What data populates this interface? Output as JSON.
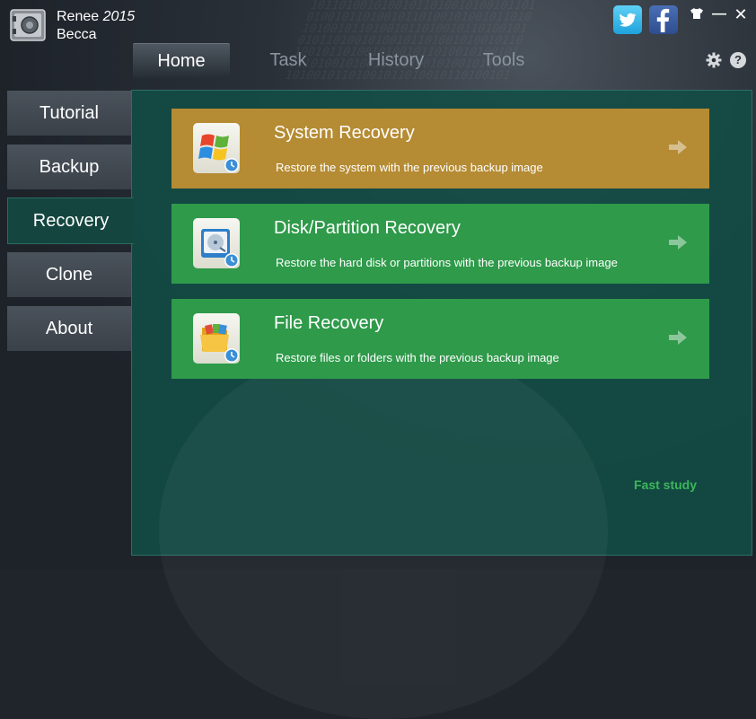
{
  "app": {
    "name": "Renee",
    "version": "2015",
    "user": "Becca"
  },
  "window_controls": {
    "minimize": "—",
    "close": "✕"
  },
  "social": {
    "twitter_icon": "twitter-icon",
    "facebook_icon": "facebook-icon"
  },
  "tabs": [
    {
      "label": "Home",
      "active": true
    },
    {
      "label": "Task",
      "active": false
    },
    {
      "label": "History",
      "active": false
    },
    {
      "label": "Tools",
      "active": false
    }
  ],
  "help_label": "?",
  "sidebar": {
    "items": [
      {
        "label": "Tutorial",
        "active": false
      },
      {
        "label": "Backup",
        "active": false
      },
      {
        "label": "Recovery",
        "active": true
      },
      {
        "label": "Clone",
        "active": false
      },
      {
        "label": "About",
        "active": false
      }
    ]
  },
  "cards": [
    {
      "title": "System Recovery",
      "desc": "Restore the system with the previous backup image",
      "color": "#b58b33",
      "icon": "windows-logo-icon"
    },
    {
      "title": "Disk/Partition Recovery",
      "desc": "Restore the hard disk or partitions with the previous backup image",
      "color": "#2e9a4a",
      "icon": "hard-disk-icon"
    },
    {
      "title": "File Recovery",
      "desc": "Restore files or folders with the previous backup image",
      "color": "#2e9a4a",
      "icon": "folder-icon"
    }
  ],
  "fast_study": "Fast study",
  "colors": {
    "accent_green": "#3cb65a",
    "panel": "#124e46"
  }
}
